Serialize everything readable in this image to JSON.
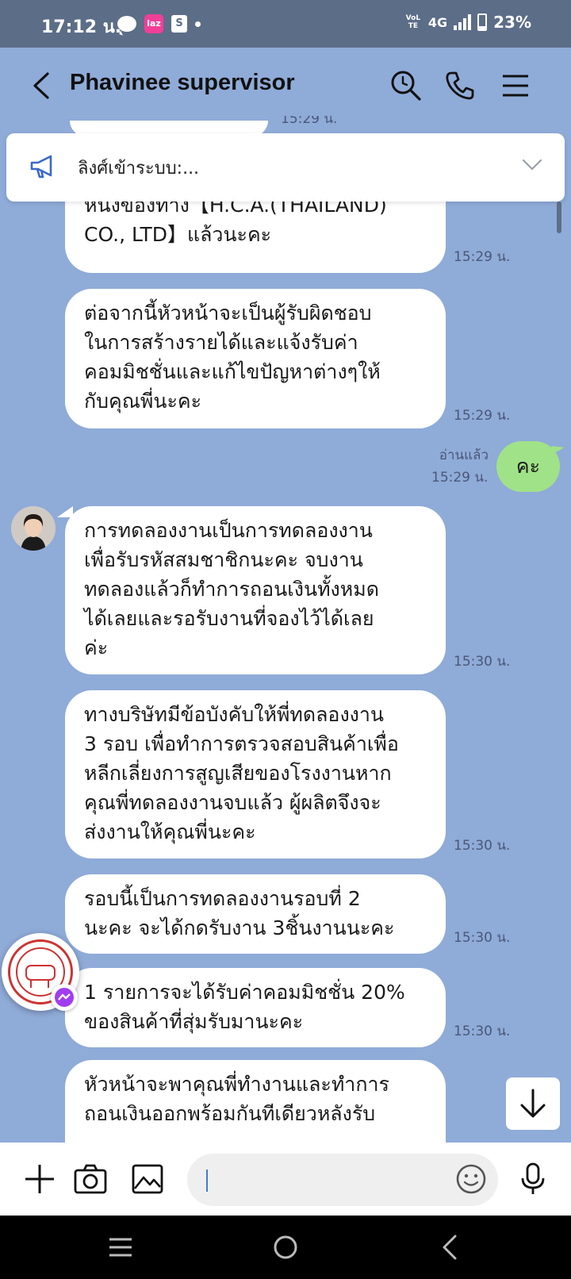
{
  "status_bar": {
    "time": "17:12 น.",
    "volte": "VoLTE",
    "network": "4G",
    "battery": "23%"
  },
  "header": {
    "title": "Phavinee supervisor"
  },
  "announcement": {
    "text": "ลิงศ์เข้าระบบ:..."
  },
  "messages": [
    {
      "text": "หนึ่งของทาง【H.C.A.(THAILAND)\nCO., LTD】แล้วนะคะ",
      "time": "15:29 น."
    },
    {
      "text": "ต่อจากนี้หัวหน้าจะเป็นผู้รับผิดชอบ\nในการสร้างรายได้และแจ้งรับค่า\nคอมมิชชั่นและแก้ไขปัญหาต่างๆให้\nกับคุณพี่นะคะ",
      "time": "15:29 น."
    },
    {
      "text": "การทดลองงานเป็นการทดลองงาน\nเพื่อรับรหัสสมชาชิกนะคะ จบงาน\nทดลองแล้วก็ทำการถอนเงินทั้งหมด\nได้เลยและรอรับงานที่จองไว้ได้เลย\nค่ะ",
      "time": "15:30 น."
    },
    {
      "text": "ทางบริษัทมีข้อบังคับให้พี่ทดลองงาน\n3 รอบ เพื่อทำการตรวจสอบสินค้าเพื่อ\nหลีกเลี่ยงการสูญเสียของโรงงานหาก\nคุณพี่ทดลองงานจบแล้ว ผู้ผลิตจึงจะ\nส่งงานให้คุณพี่นะคะ",
      "time": "15:30 น."
    },
    {
      "text": "รอบนี้เป็นการทดลองงานรอบที่ 2\nนะคะ จะได้กดรับงาน  3ชิ้นงานนะคะ",
      "time": "15:30 น."
    },
    {
      "text": "1 รายการจะได้รับค่าคอมมิชชั่น 20%\nของสินค้าที่สุ่มรับมานะคะ",
      "time": "15:30 น."
    },
    {
      "text": "หัวหน้าจะพาคุณพี่ทำงานและทำการ\nถอนเงินออกพร้อมกันทีเดียวหลังรับ",
      "time": ""
    }
  ],
  "partial_top_time": "15:29 น.",
  "my_message": {
    "text": "คะ",
    "read_label": "อ่านแล้ว",
    "time": "15:29 น."
  },
  "input": {
    "placeholder": ""
  },
  "colors": {
    "background": "#8fabd8",
    "my_bubble": "#a0e287",
    "status_bar": "#5c6d88"
  }
}
